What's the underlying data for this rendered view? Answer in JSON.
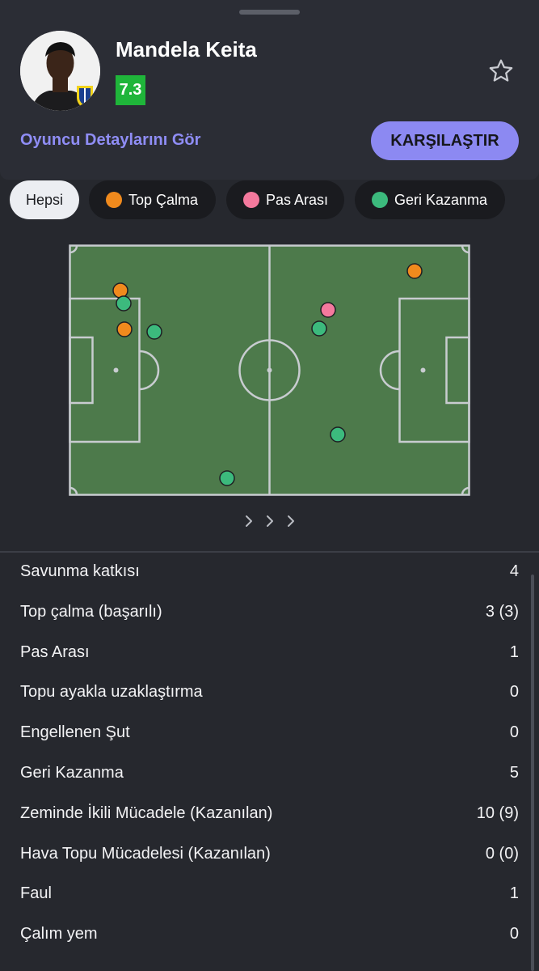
{
  "player": {
    "name": "Mandela Keita",
    "rating": "7.3",
    "details_link": "Oyuncu Detaylarını Gör",
    "compare_label": "KARŞILAŞTIR"
  },
  "filters": [
    {
      "label": "Hepsi",
      "active": true
    },
    {
      "label": "Top Çalma",
      "color": "#f08a1d"
    },
    {
      "label": "Pas Arası",
      "color": "#f4799d"
    },
    {
      "label": "Geri Kazanma",
      "color": "#3cba7d"
    }
  ],
  "colors": {
    "accent": "#8c89f2",
    "rating": "#1fb53a",
    "pitch": "#4d7a4b",
    "top_calma": "#f08a1d",
    "pas_arasi": "#f4799d",
    "geri_kazanma": "#3cba7d"
  },
  "icons": [
    "star-icon",
    "chevron-right-icon"
  ],
  "stats": [
    {
      "label": "Savunma katkısı",
      "value": "4"
    },
    {
      "label": "Top çalma (başarılı)",
      "value": "3 (3)"
    },
    {
      "label": "Pas Arası",
      "value": "1"
    },
    {
      "label": "Topu ayakla uzaklaştırma",
      "value": "0"
    },
    {
      "label": "Engellenen Şut",
      "value": "0"
    },
    {
      "label": "Geri Kazanma",
      "value": "5"
    },
    {
      "label": "Zeminde İkili Mücadele (Kazanılan)",
      "value": "10 (9)"
    },
    {
      "label": "Hava Topu Mücadelesi (Kazanılan)",
      "value": "0 (0)"
    },
    {
      "label": "Faul",
      "value": "1"
    },
    {
      "label": "Çalım yem",
      "value": "0"
    }
  ]
}
